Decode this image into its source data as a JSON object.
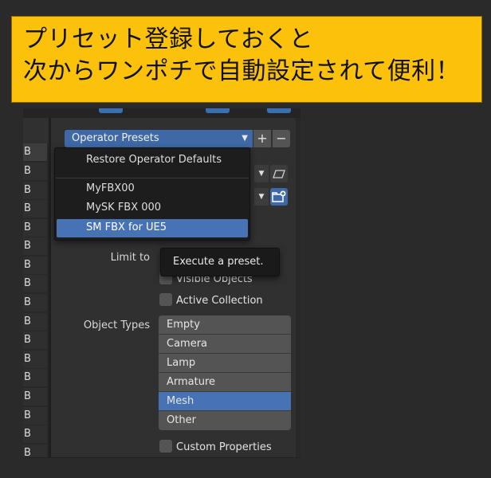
{
  "banner": {
    "line1": "プリセット登録しておくと",
    "line2": "次からワンポチで自動設定されて便利！"
  },
  "left_list": [
    "B",
    "B",
    "B",
    "B",
    "B",
    "B",
    "B",
    "B",
    "B",
    "B",
    "B",
    "B",
    "B",
    "B",
    "B",
    "B",
    "B"
  ],
  "preset_header": {
    "label": "Operator Presets",
    "add_label": "+",
    "remove_label": "−"
  },
  "menu": {
    "restore": "Restore Operator Defaults",
    "presets": [
      "MyFBX00",
      "MySK FBX 000",
      "SM FBX for UE5"
    ],
    "selected_index": 2
  },
  "form": {
    "limit_to_label": "Limit to",
    "tooltip": "Execute a preset.",
    "visible_objects": "Visible Objects",
    "active_collection": "Active Collection",
    "object_types_label": "Object Types",
    "object_types": [
      "Empty",
      "Camera",
      "Lamp",
      "Armature",
      "Mesh",
      "Other"
    ],
    "active_type": "Mesh",
    "custom_properties": "Custom Properties"
  },
  "colors": {
    "banner_bg": "#fcc10a",
    "accent_blue": "#4772b3",
    "panel_bg": "#303030"
  }
}
